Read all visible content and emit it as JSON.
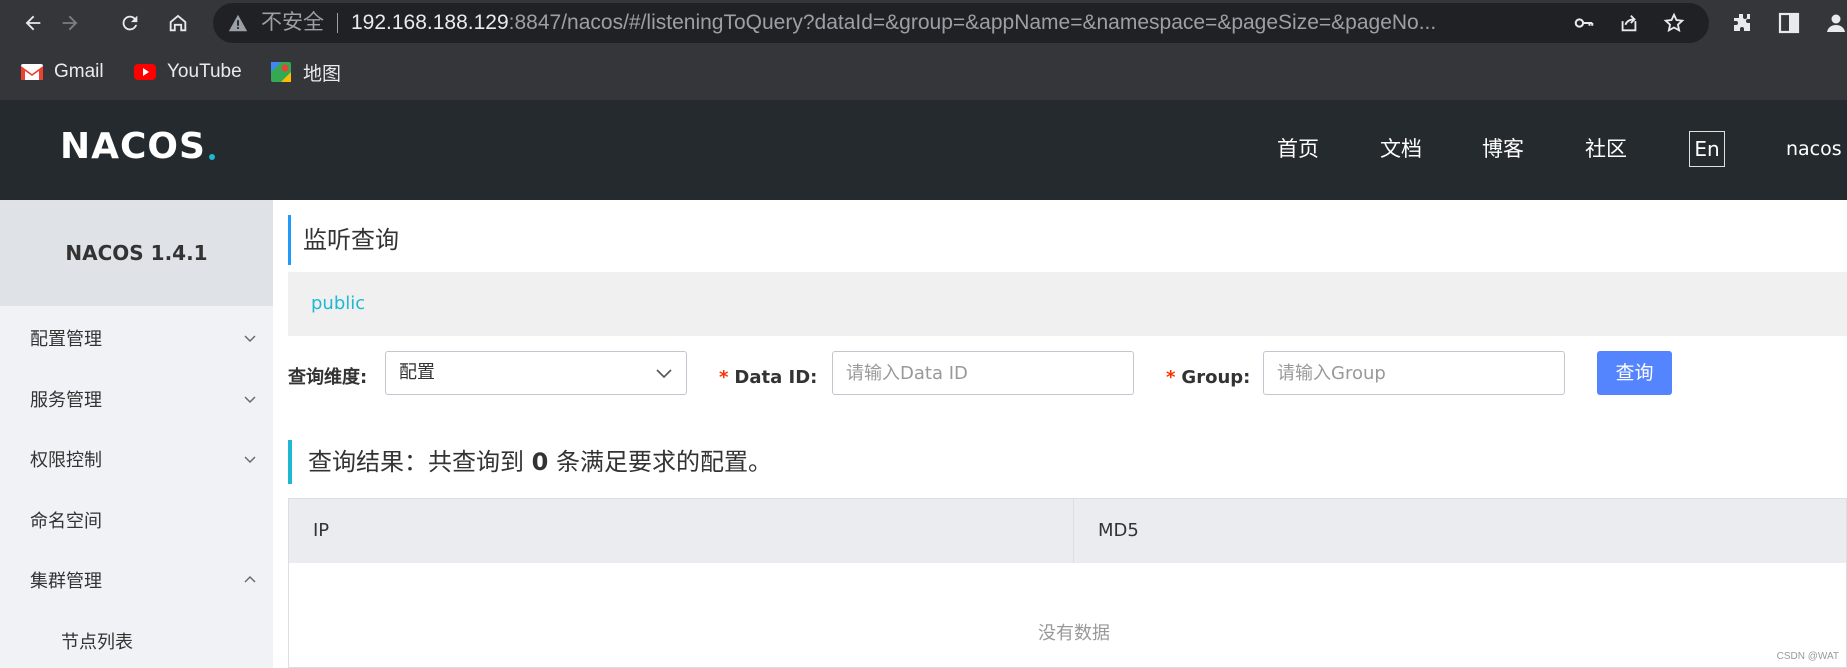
{
  "browser": {
    "insecure_label": "不安全",
    "url_host": "192.168.188.129",
    "url_rest": ":8847/nacos/#/listeningToQuery?dataId=&group=&appName=&namespace=&pageSize=&pageNo...",
    "bookmarks": [
      {
        "label": "Gmail",
        "icon": "gmail-icon"
      },
      {
        "label": "YouTube",
        "icon": "youtube-icon"
      },
      {
        "label": "地图",
        "icon": "maps-icon"
      }
    ]
  },
  "header": {
    "logo": "NACOS",
    "nav": [
      "首页",
      "文档",
      "博客",
      "社区"
    ],
    "lang": "En",
    "user": "nacos"
  },
  "sidebar": {
    "title": "NACOS 1.4.1",
    "items": [
      {
        "label": "配置管理",
        "expanded": false
      },
      {
        "label": "服务管理",
        "expanded": false
      },
      {
        "label": "权限控制",
        "expanded": false
      },
      {
        "label": "命名空间"
      },
      {
        "label": "集群管理",
        "expanded": true
      },
      {
        "label": "节点列表"
      }
    ]
  },
  "main": {
    "title": "监听查询",
    "namespace": "public",
    "form": {
      "dimension_label": "查询维度:",
      "dimension_value": "配置",
      "dataid_label": "Data ID:",
      "dataid_placeholder": "请输入Data ID",
      "group_label": "Group:",
      "group_placeholder": "请输入Group",
      "query_button": "查询",
      "required_mark": "*"
    },
    "result": {
      "prefix": "查询结果：共查询到",
      "count": "0",
      "suffix": "条满足要求的配置。"
    },
    "table": {
      "columns": [
        "IP",
        "MD5"
      ],
      "empty_text": "没有数据"
    }
  },
  "watermark": "CSDN @WAT",
  "colors": {
    "header_bg": "#252a2f",
    "accent": "#1fb8d3",
    "button": "#5584ff"
  }
}
